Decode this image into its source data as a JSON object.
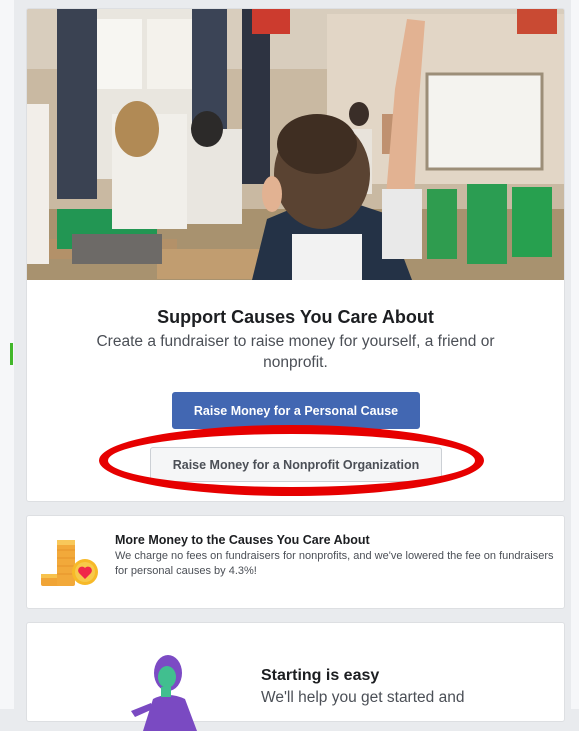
{
  "hero": {
    "title": "Support Causes You Care About",
    "subtitle": "Create a fundraiser to raise money for yourself, a friend or nonprofit.",
    "primary_button": "Raise Money for a Personal Cause",
    "secondary_button": "Raise Money for a Nonprofit Organization"
  },
  "fees_card": {
    "title": "More Money to the Causes You Care About",
    "text": "We charge no fees on fundraisers for nonprofits, and we've lowered the fee on fundraisers for personal causes by 4.3%!"
  },
  "easy_card": {
    "title": "Starting is easy",
    "text": "We'll help you get started and"
  },
  "colors": {
    "primary_button": "#4267b2",
    "highlight_oval": "#e60000",
    "page_background": "#e9ebee"
  },
  "icons": [
    "classroom-photo",
    "coins-heart-icon",
    "person-illustration-icon"
  ]
}
